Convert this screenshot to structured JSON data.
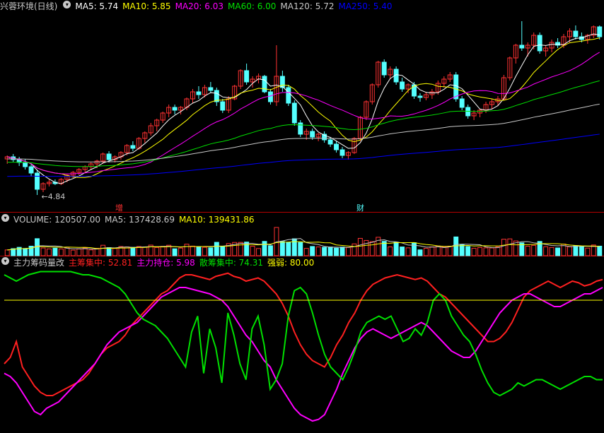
{
  "panels": {
    "price": {
      "title": "兴蓉环境(日线)",
      "mas": [
        {
          "label": "MA5: 5.74",
          "color": "#ffffff"
        },
        {
          "label": "MA10: 5.85",
          "color": "#ffff00"
        },
        {
          "label": "MA20: 6.03",
          "color": "#ff00ff"
        },
        {
          "label": "MA60: 6.00",
          "color": "#00e000"
        },
        {
          "label": "MA120: 5.72",
          "color": "#c8c8c8"
        },
        {
          "label": "MA250: 5.40",
          "color": "#0000ff"
        }
      ],
      "low_label": "←4.84",
      "marker_zeng": "增",
      "marker_cai": "财"
    },
    "volume": {
      "title": "VOLUME: 120507.00",
      "ma5": "MA5: 137428.69",
      "ma10": "MA10: 139431.86"
    },
    "indicator": {
      "title": "主力筹码量改",
      "items": [
        {
          "label": "主筹集中: 52.81",
          "color": "#ff2020"
        },
        {
          "label": "主力持仓: 5.98",
          "color": "#ff00ff"
        },
        {
          "label": "散筹集中: 74.31",
          "color": "#00e000"
        },
        {
          "label": "强弱: 80.00",
          "color": "#ffff00"
        }
      ]
    }
  },
  "colors": {
    "up": "#ff3232",
    "down": "#54ffff",
    "bg": "#000000",
    "sep": "#b40000"
  },
  "chart_data": [
    {
      "type": "candlestick",
      "series_name": "兴蓉环境(日线)",
      "candles": [
        [
          5.35,
          5.4,
          5.28,
          5.38
        ],
        [
          5.38,
          5.42,
          5.3,
          5.34
        ],
        [
          5.34,
          5.38,
          5.25,
          5.3
        ],
        [
          5.3,
          5.35,
          5.2,
          5.24
        ],
        [
          5.24,
          5.28,
          5.1,
          5.15
        ],
        [
          5.15,
          5.2,
          4.84,
          4.92
        ],
        [
          4.92,
          5.02,
          4.88,
          5.0
        ],
        [
          5.0,
          5.06,
          4.96,
          5.02
        ],
        [
          5.02,
          5.06,
          4.98,
          5.0
        ],
        [
          5.0,
          5.08,
          4.98,
          5.06
        ],
        [
          5.06,
          5.14,
          5.02,
          5.12
        ],
        [
          5.12,
          5.18,
          5.08,
          5.16
        ],
        [
          5.16,
          5.22,
          5.12,
          5.2
        ],
        [
          5.2,
          5.26,
          5.16,
          5.24
        ],
        [
          5.24,
          5.3,
          5.2,
          5.28
        ],
        [
          5.28,
          5.34,
          5.22,
          5.32
        ],
        [
          5.32,
          5.44,
          5.28,
          5.42
        ],
        [
          5.42,
          5.46,
          5.3,
          5.34
        ],
        [
          5.34,
          5.4,
          5.3,
          5.38
        ],
        [
          5.38,
          5.46,
          5.34,
          5.44
        ],
        [
          5.44,
          5.56,
          5.4,
          5.54
        ],
        [
          5.54,
          5.6,
          5.46,
          5.5
        ],
        [
          5.5,
          5.66,
          5.48,
          5.64
        ],
        [
          5.64,
          5.74,
          5.58,
          5.72
        ],
        [
          5.72,
          5.86,
          5.68,
          5.82
        ],
        [
          5.82,
          5.92,
          5.74,
          5.9
        ],
        [
          5.9,
          6.02,
          5.86,
          6.0
        ],
        [
          6.0,
          6.12,
          5.94,
          6.08
        ],
        [
          6.08,
          6.12,
          5.98,
          6.04
        ],
        [
          6.04,
          6.1,
          5.98,
          6.08
        ],
        [
          6.08,
          6.22,
          6.04,
          6.2
        ],
        [
          6.2,
          6.34,
          6.14,
          6.3
        ],
        [
          6.3,
          6.38,
          6.2,
          6.26
        ],
        [
          6.26,
          6.4,
          6.22,
          6.36
        ],
        [
          6.36,
          6.44,
          6.28,
          6.32
        ],
        [
          6.32,
          6.36,
          6.1,
          6.16
        ],
        [
          6.16,
          6.2,
          6.0,
          6.04
        ],
        [
          6.04,
          6.24,
          6.0,
          6.2
        ],
        [
          6.2,
          6.4,
          6.18,
          6.38
        ],
        [
          6.38,
          6.62,
          6.34,
          6.6
        ],
        [
          6.6,
          6.7,
          6.4,
          6.44
        ],
        [
          6.44,
          6.52,
          6.36,
          6.48
        ],
        [
          6.48,
          6.56,
          6.42,
          6.52
        ],
        [
          6.52,
          6.54,
          6.28,
          6.3
        ],
        [
          6.3,
          6.34,
          6.12,
          6.16
        ],
        [
          6.16,
          6.96,
          6.1,
          6.52
        ],
        [
          6.52,
          6.6,
          6.3,
          6.36
        ],
        [
          6.36,
          6.4,
          6.1,
          6.14
        ],
        [
          6.14,
          6.18,
          5.82,
          5.86
        ],
        [
          5.86,
          5.9,
          5.66,
          5.7
        ],
        [
          5.7,
          5.78,
          5.62,
          5.74
        ],
        [
          5.74,
          5.78,
          5.62,
          5.66
        ],
        [
          5.66,
          5.72,
          5.6,
          5.7
        ],
        [
          5.7,
          5.74,
          5.58,
          5.62
        ],
        [
          5.62,
          5.66,
          5.52,
          5.56
        ],
        [
          5.56,
          5.6,
          5.44,
          5.48
        ],
        [
          5.48,
          5.52,
          5.36,
          5.4
        ],
        [
          5.4,
          5.46,
          5.34,
          5.44
        ],
        [
          5.44,
          5.66,
          5.42,
          5.64
        ],
        [
          5.64,
          5.96,
          5.6,
          5.94
        ],
        [
          5.94,
          6.18,
          5.9,
          6.16
        ],
        [
          6.16,
          6.42,
          6.12,
          6.4
        ],
        [
          6.4,
          6.74,
          6.36,
          6.72
        ],
        [
          6.72,
          6.76,
          6.5,
          6.54
        ],
        [
          6.54,
          6.66,
          6.48,
          6.62
        ],
        [
          6.62,
          6.66,
          6.4,
          6.44
        ],
        [
          6.44,
          6.5,
          6.3,
          6.34
        ],
        [
          6.34,
          6.42,
          6.28,
          6.4
        ],
        [
          6.4,
          6.44,
          6.2,
          6.24
        ],
        [
          6.24,
          6.28,
          6.16,
          6.22
        ],
        [
          6.22,
          6.3,
          6.18,
          6.26
        ],
        [
          6.26,
          6.34,
          6.2,
          6.3
        ],
        [
          6.3,
          6.46,
          6.26,
          6.42
        ],
        [
          6.42,
          6.52,
          6.36,
          6.48
        ],
        [
          6.48,
          6.58,
          6.44,
          6.54
        ],
        [
          6.54,
          6.58,
          6.16,
          6.2
        ],
        [
          6.2,
          6.24,
          6.04,
          6.08
        ],
        [
          6.08,
          6.12,
          5.92,
          5.96
        ],
        [
          5.96,
          6.04,
          5.9,
          6.0
        ],
        [
          6.0,
          6.06,
          5.94,
          6.04
        ],
        [
          6.04,
          6.16,
          6.0,
          6.12
        ],
        [
          6.12,
          6.2,
          6.06,
          6.16
        ],
        [
          6.16,
          6.24,
          6.1,
          6.2
        ],
        [
          6.2,
          6.54,
          6.18,
          6.5
        ],
        [
          6.5,
          6.8,
          6.46,
          6.78
        ],
        [
          6.78,
          6.98,
          6.7,
          6.96
        ],
        [
          6.96,
          7.3,
          6.88,
          6.92
        ],
        [
          6.92,
          7.0,
          6.8,
          6.96
        ],
        [
          6.96,
          7.14,
          6.9,
          7.1
        ],
        [
          7.1,
          7.14,
          6.84,
          6.88
        ],
        [
          6.88,
          6.96,
          6.8,
          6.92
        ],
        [
          6.92,
          7.04,
          6.86,
          7.0
        ],
        [
          7.0,
          7.06,
          6.92,
          6.96
        ],
        [
          6.96,
          7.12,
          6.92,
          7.08
        ],
        [
          7.08,
          7.2,
          7.0,
          7.16
        ],
        [
          7.16,
          7.24,
          7.04,
          7.08
        ],
        [
          7.08,
          7.14,
          7.0,
          7.04
        ],
        [
          7.04,
          7.12,
          6.98,
          7.1
        ],
        [
          7.1,
          7.24,
          7.06,
          7.22
        ],
        [
          7.22,
          7.24,
          7.04,
          7.08
        ]
      ],
      "ma5_last": 5.74,
      "ma10_last": 5.85,
      "ma20_last": 6.03,
      "ma60_last": 6.0,
      "ma120_last": 5.72,
      "ma250_last": 5.4,
      "low_marked": 4.84
    },
    {
      "type": "bar",
      "series_name": "VOLUME",
      "last_value": 120507.0,
      "ma5": 137428.69,
      "ma10": 139431.86
    },
    {
      "type": "line",
      "series": [
        {
          "name": "主筹集中",
          "last": 52.81,
          "values": [
            40,
            44,
            54,
            38,
            32,
            26,
            22,
            20,
            20,
            22,
            24,
            26,
            28,
            30,
            34,
            40,
            46,
            50,
            52,
            54,
            58,
            64,
            68,
            72,
            76,
            80,
            84,
            86,
            90,
            94,
            96,
            96,
            95,
            94,
            93,
            95,
            96,
            97,
            95,
            94,
            92,
            93,
            94,
            92,
            88,
            84,
            78,
            70,
            60,
            52,
            46,
            42,
            40,
            38,
            44,
            52,
            58,
            66,
            72,
            80,
            86,
            90,
            92,
            94,
            95,
            96,
            95,
            94,
            93,
            94,
            92,
            88,
            84,
            82,
            78,
            74,
            70,
            66,
            62,
            58,
            54,
            54,
            56,
            60,
            66,
            74,
            82,
            86,
            88,
            90,
            92,
            90,
            88,
            90,
            92,
            91,
            89,
            90,
            92,
            93
          ]
        },
        {
          "name": "主力持仓",
          "last": 5.98,
          "values": [
            34,
            32,
            28,
            22,
            16,
            10,
            8,
            12,
            14,
            16,
            20,
            24,
            28,
            32,
            36,
            40,
            46,
            52,
            56,
            60,
            62,
            64,
            66,
            70,
            74,
            78,
            82,
            84,
            86,
            88,
            88,
            87,
            86,
            85,
            84,
            82,
            80,
            76,
            70,
            64,
            58,
            54,
            48,
            42,
            38,
            30,
            24,
            18,
            12,
            8,
            6,
            4,
            5,
            8,
            16,
            24,
            34,
            42,
            50,
            56,
            60,
            62,
            60,
            58,
            56,
            58,
            60,
            62,
            64,
            66,
            64,
            60,
            56,
            52,
            48,
            46,
            44,
            44,
            48,
            54,
            60,
            66,
            72,
            76,
            80,
            82,
            84,
            84,
            82,
            80,
            78,
            76,
            76,
            78,
            80,
            82,
            84,
            84,
            86,
            88
          ]
        },
        {
          "name": "散筹集中",
          "last": 74.31,
          "values": [
            96,
            94,
            92,
            94,
            96,
            97,
            98,
            98,
            98,
            98,
            98,
            98,
            97,
            96,
            96,
            95,
            94,
            92,
            90,
            88,
            84,
            78,
            72,
            68,
            66,
            64,
            60,
            56,
            50,
            44,
            38,
            60,
            70,
            34,
            62,
            50,
            28,
            72,
            58,
            40,
            30,
            62,
            70,
            52,
            24,
            30,
            40,
            70,
            86,
            88,
            84,
            72,
            58,
            46,
            38,
            34,
            30,
            38,
            48,
            60,
            66,
            68,
            70,
            68,
            70,
            62,
            54,
            56,
            62,
            58,
            66,
            80,
            84,
            80,
            70,
            64,
            58,
            54,
            46,
            36,
            28,
            22,
            20,
            22,
            24,
            28,
            26,
            28,
            30,
            30,
            28,
            26,
            24,
            26,
            28,
            30,
            32,
            32,
            30,
            30
          ]
        },
        {
          "name": "强弱",
          "last": 80.0,
          "values": [
            80,
            80,
            80,
            80,
            80,
            80,
            80,
            80,
            80,
            80,
            80,
            80,
            80,
            80,
            80,
            80,
            80,
            80,
            80,
            80,
            80,
            80,
            80,
            80,
            80,
            80,
            80,
            80,
            80,
            80,
            80,
            80,
            80,
            80,
            80,
            80,
            80,
            80,
            80,
            80,
            80,
            80,
            80,
            80,
            80,
            80,
            80,
            80,
            80,
            80,
            80,
            80,
            80,
            80,
            80,
            80,
            80,
            80,
            80,
            80,
            80,
            80,
            80,
            80,
            80,
            80,
            80,
            80,
            80,
            80,
            80,
            80,
            80,
            80,
            80,
            80,
            80,
            80,
            80,
            80,
            80,
            80,
            80,
            80,
            80,
            80,
            80,
            80,
            80,
            80,
            80,
            80,
            80,
            80,
            80,
            80,
            80,
            80,
            80,
            80
          ]
        }
      ],
      "ylim": [
        0,
        100
      ]
    }
  ]
}
